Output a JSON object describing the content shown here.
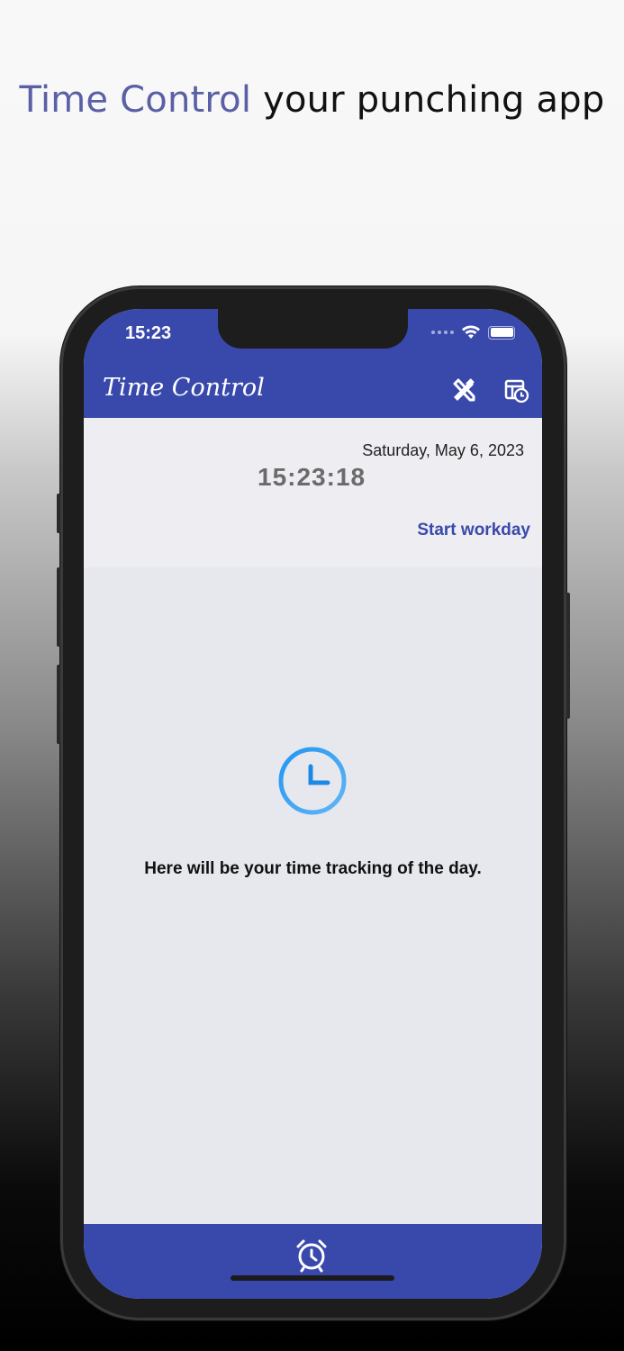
{
  "headline": {
    "accent": "Time Control",
    "rest": " your punching app"
  },
  "status_bar": {
    "time": "15:23",
    "icons": [
      "signal-dots-icon",
      "wifi-icon",
      "battery-icon"
    ]
  },
  "app_bar": {
    "title": "Time Control",
    "actions": [
      "tools-icon",
      "calendar-clock-icon"
    ]
  },
  "header": {
    "date": "Saturday, May 6, 2023",
    "clock": "15:23:18",
    "start_label": "Start workday"
  },
  "empty_state": {
    "icon": "clock-icon",
    "text": "Here will be your time tracking of the day."
  },
  "bottom_bar": {
    "icon": "alarm-clock-icon"
  },
  "colors": {
    "primary": "#3949ab",
    "accent_text": "#5a5fa6",
    "clock_icon": "#42a5f5"
  }
}
